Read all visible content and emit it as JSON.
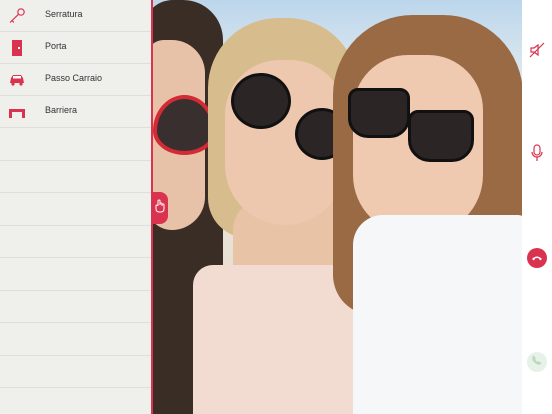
{
  "menu": {
    "items": [
      {
        "label": "Serratura",
        "icon": "key-icon"
      },
      {
        "label": "Porta",
        "icon": "door-icon"
      },
      {
        "label": "Passo Carraio",
        "icon": "car-icon"
      },
      {
        "label": "Barriera",
        "icon": "barrier-icon"
      }
    ]
  },
  "controls": {
    "mute": "mute-speaker-icon",
    "mic": "microphone-icon",
    "hangup": "hang-up-phone-icon",
    "answer": "answer-phone-icon",
    "touch": "touch-hand-icon"
  },
  "colors": {
    "accent": "#d9334f",
    "sidebar_bg": "#efefeb",
    "answer_disabled": "#e6f1e8"
  }
}
